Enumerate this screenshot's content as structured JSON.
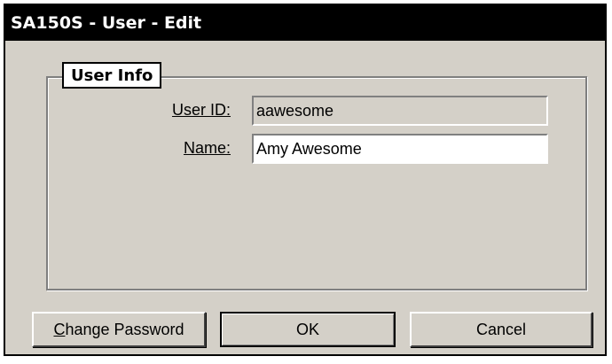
{
  "window": {
    "title": "SA150S - User - Edit"
  },
  "group": {
    "label": "User Info"
  },
  "fields": {
    "user_id": {
      "label": "User ID:",
      "value": "aawesome"
    },
    "name": {
      "label": "Name:",
      "value": "Amy Awesome"
    }
  },
  "buttons": {
    "change_password": {
      "mnemonic": "C",
      "rest": "hange Password"
    },
    "ok": "OK",
    "cancel": "Cancel"
  }
}
